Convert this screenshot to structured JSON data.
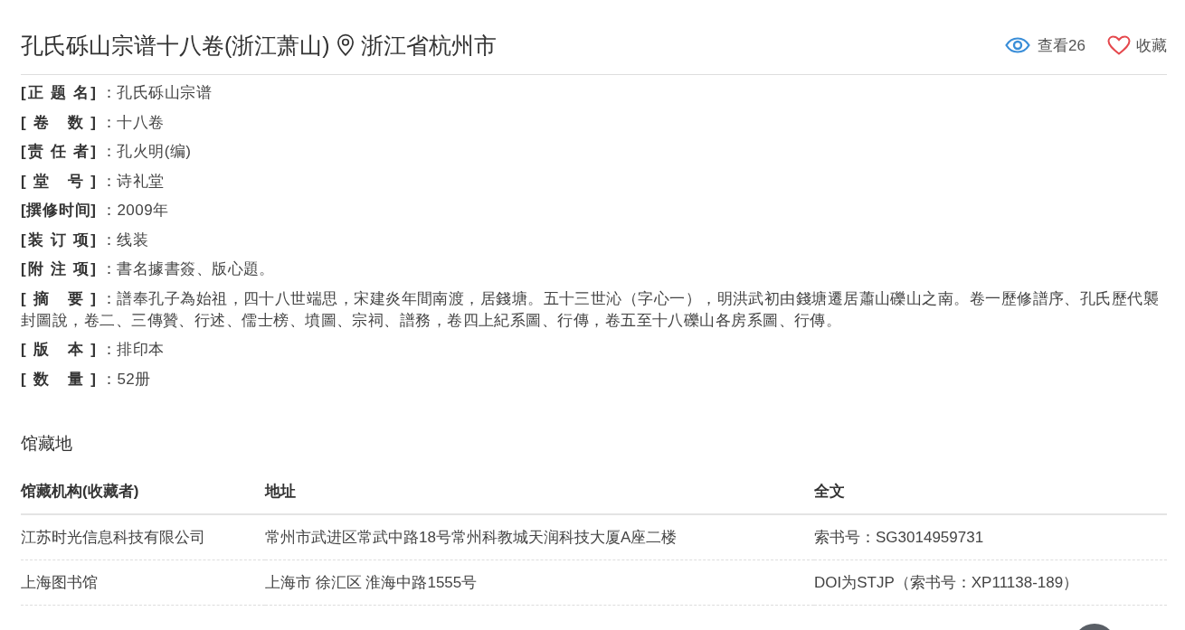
{
  "header": {
    "title": "孔氏砾山宗谱十八卷(浙江萧山)",
    "location": "浙江省杭州市",
    "views": "查看26",
    "favorite": "收藏"
  },
  "fields": [
    {
      "label": "[正 题 名]",
      "value": "：孔氏砾山宗谱"
    },
    {
      "label": "[卷 数]",
      "value": "：十八卷"
    },
    {
      "label": "[责 任 者]",
      "value": "：孔火明(编)"
    },
    {
      "label": "[堂 号]",
      "value": "：诗礼堂"
    },
    {
      "label": "[撰修时间]",
      "value": "：2009年"
    },
    {
      "label": "[装 订 项]",
      "value": "：线装"
    },
    {
      "label": "[附 注 项]",
      "value": "：書名據書簽、版心題。"
    },
    {
      "label": "[摘 要]",
      "value": "：譜奉孔子為始祖，四十八世端思，宋建炎年間南渡，居錢塘。五十三世沁（字心一），明洪武初由錢塘遷居蕭山礫山之南。卷一歷修譜序、孔氏歷代襲封圖說，卷二、三傳贊、行述、儒士榜、墳圖、宗祠、譜務，卷四上紀系圖、行傳，卷五至十八礫山各房系圖、行傳。"
    },
    {
      "label": "[版 本]",
      "value": "：排印本"
    },
    {
      "label": "[数 量]",
      "value": "：52册"
    }
  ],
  "holdings": {
    "title": "馆藏地",
    "columns": [
      "馆藏机构(收藏者)",
      "地址",
      "全文"
    ],
    "rows": [
      [
        "江苏时光信息科技有限公司",
        "常州市武进区常武中路18号常州科教城天润科技大厦A座二楼",
        "索书号：SG3014959731"
      ],
      [
        "上海图书馆",
        "上海市 徐汇区 淮海中路1555号",
        "DOI为STJP（索书号：XP11138-189）"
      ]
    ]
  }
}
